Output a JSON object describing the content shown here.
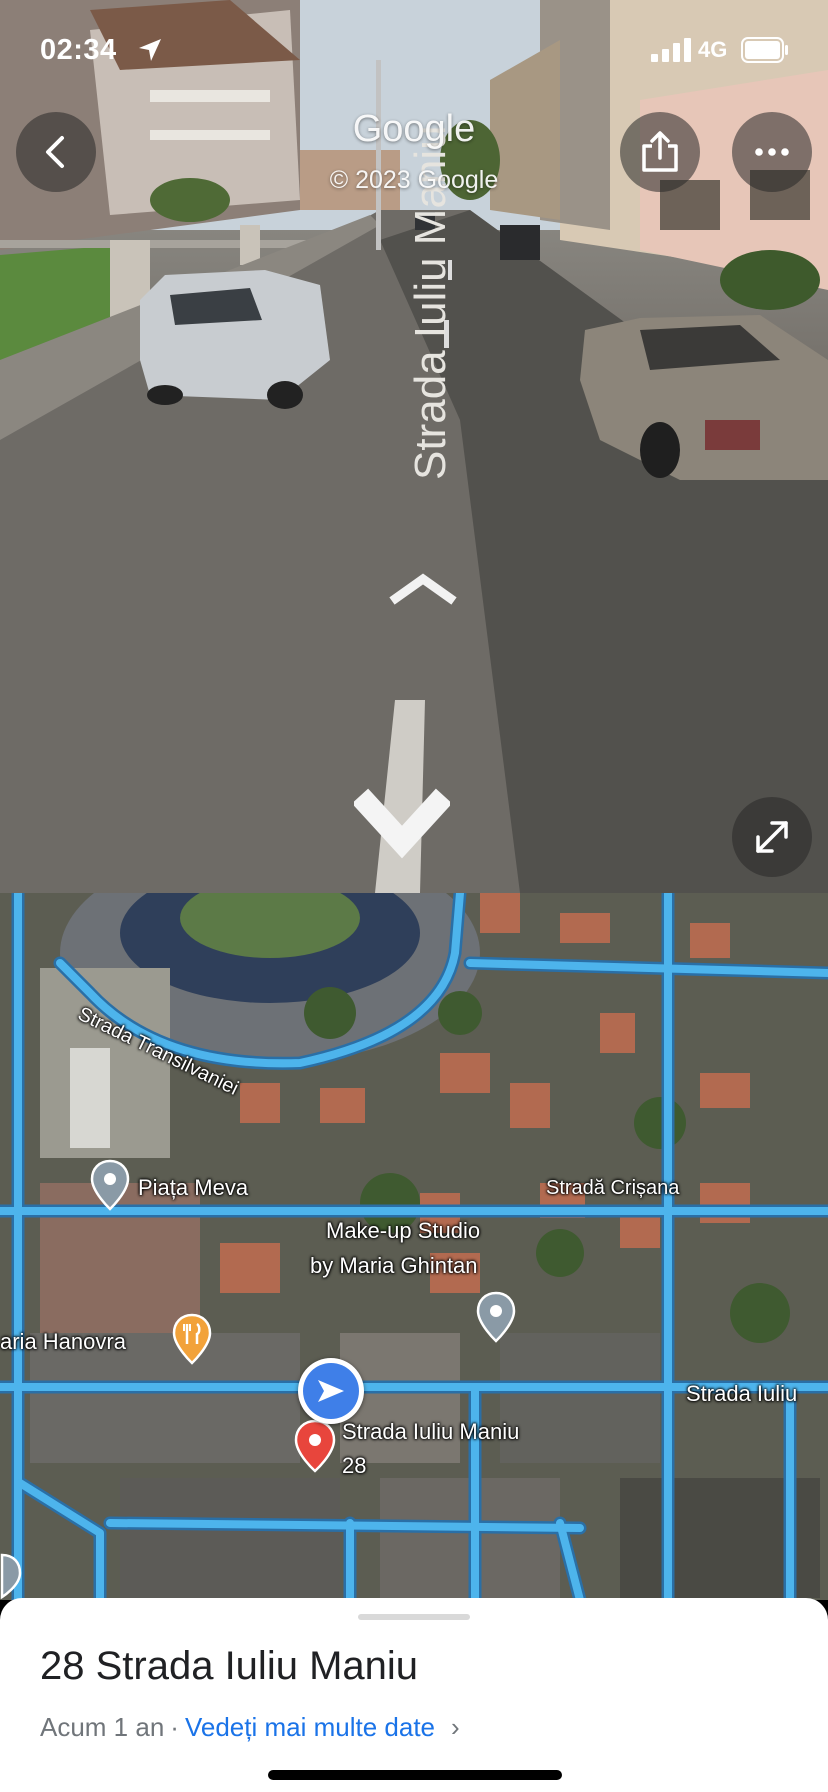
{
  "status_bar": {
    "time": "02:34",
    "network": "4G",
    "icons": [
      "location-arrow-icon",
      "signal-bars-icon",
      "battery-icon"
    ]
  },
  "street_view": {
    "watermark_logo": "Google",
    "watermark_copyright": "© 2023 Google",
    "road_text": "Strada Iuliu Maniu",
    "buttons": {
      "back": "chevron-left-icon",
      "share": "share-icon",
      "more": "more-horizontal-icon",
      "expand": "expand-diagonal-icon"
    },
    "nav_arrows": [
      "chevron-up-icon",
      "chevron-down-icon"
    ]
  },
  "map": {
    "labels": {
      "transilvaniei": "Strada Transilvaniei",
      "piata_meva": "Piața Meva",
      "crisana": "Stradă Crișana",
      "makeup_line1": "Make-up Studio",
      "makeup_line2": "by Maria Ghintan",
      "hanovra": "aria Hanovra",
      "iuliu_right": "Strada Iuliu",
      "current_line1": "Strada Iuliu Maniu",
      "current_line2": "28"
    },
    "icons": [
      "location-pin-icon",
      "restaurant-icon",
      "street-view-arrow-icon",
      "red-pin-icon"
    ],
    "colors": {
      "road": "#4db4ec",
      "pin_gray": "#8a9aa6",
      "pin_orange": "#f2a23a",
      "pin_red": "#e8453c",
      "viewer_blue": "#3f7fe8"
    }
  },
  "sheet": {
    "title": "28 Strada Iuliu Maniu",
    "date_text": "Acum 1 an",
    "separator": "·",
    "link_text": "Vedeți mai multe date",
    "chevron": "›"
  }
}
